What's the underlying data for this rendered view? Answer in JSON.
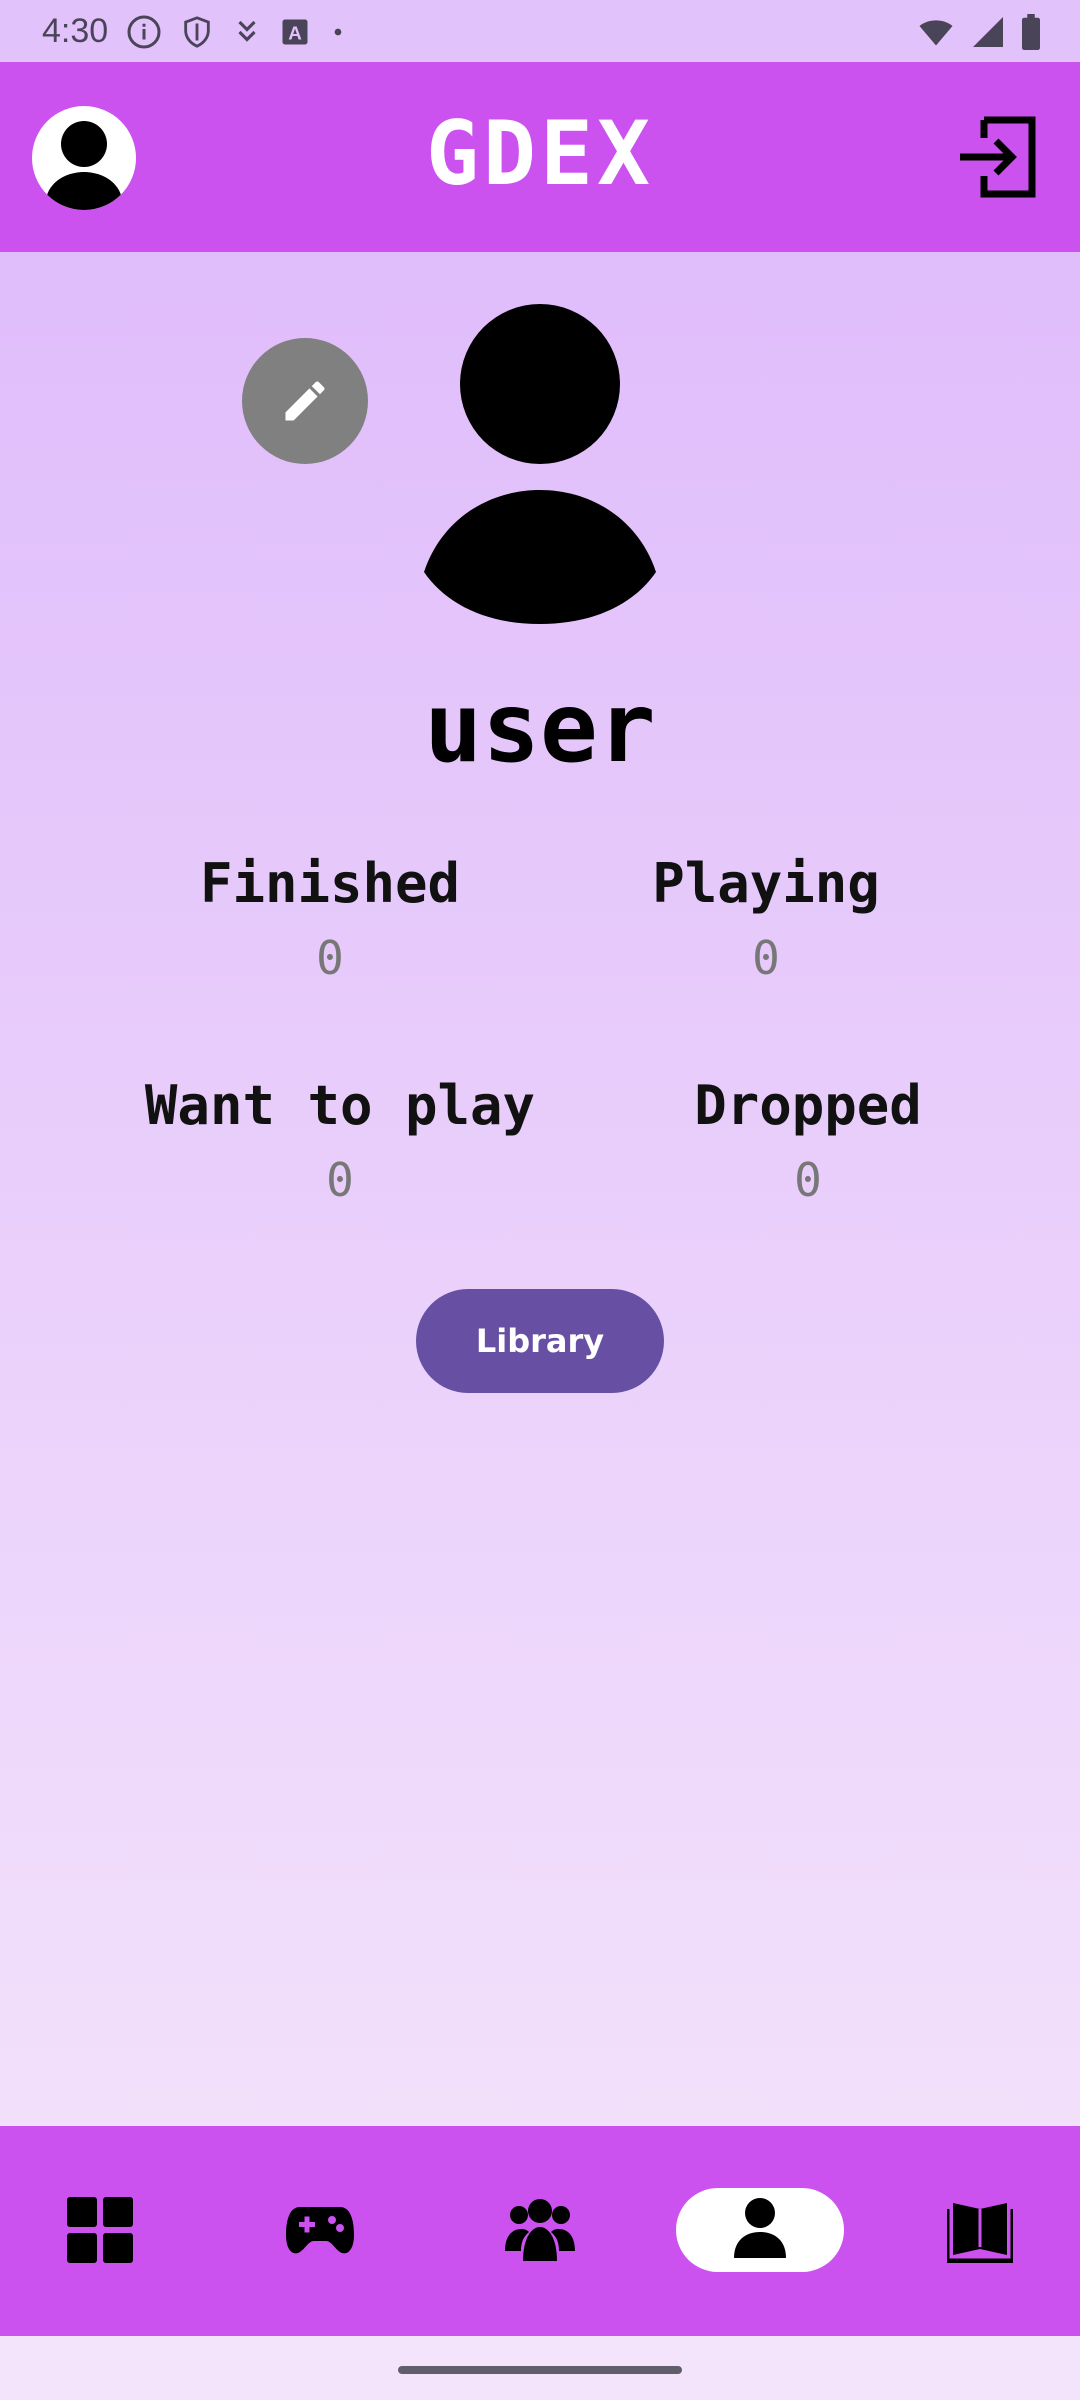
{
  "status_bar": {
    "time": "4:30",
    "left_icons": [
      "info-icon",
      "shield-icon",
      "download-icon",
      "app-a-icon",
      "dot-icon"
    ],
    "right_icons": [
      "wifi-icon",
      "signal-icon",
      "battery-icon"
    ]
  },
  "app_bar": {
    "title": "GDEX",
    "left_icon": "account-circle-icon",
    "right_icon": "logout-icon"
  },
  "profile": {
    "username": "user",
    "edit_icon": "pencil-icon"
  },
  "stats": [
    {
      "label": "Finished",
      "value": "0"
    },
    {
      "label": "Playing",
      "value": "0"
    },
    {
      "label": "Want to play",
      "value": "0"
    },
    {
      "label": "Dropped",
      "value": "0"
    }
  ],
  "library_button": "Library",
  "bottom_nav": {
    "items": [
      "dashboard-icon",
      "gamepad-icon",
      "people-icon",
      "person-icon",
      "book-icon"
    ],
    "active_index": 3
  },
  "colors": {
    "app_bar": "#cc52f0",
    "button": "#6750a4",
    "status_bar": "#e2c2fa"
  }
}
